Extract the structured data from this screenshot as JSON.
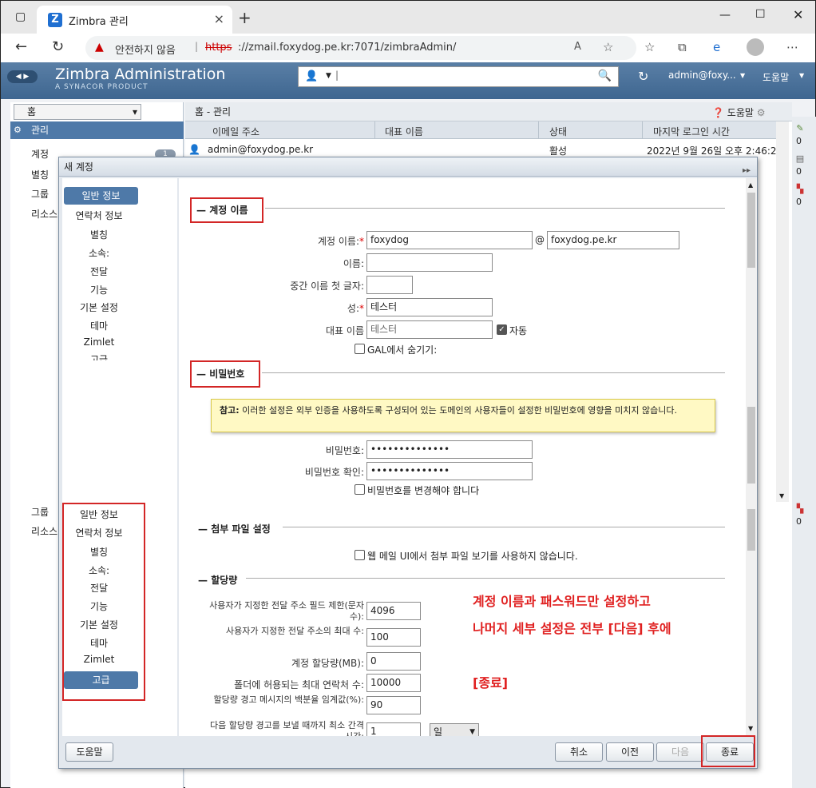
{
  "browser": {
    "tab_title": "Zimbra 관리",
    "tab_logo": "Z",
    "security_warning": "안전하지 않음",
    "url_scheme": "https",
    "url_rest": "://zmail.foxydog.pe.kr:7071/zimbraAdmin/"
  },
  "zimbra_header": {
    "brand": "Zimbra Administration",
    "subtitle": "A SYNACOR PRODUCT",
    "user": "admin@foxy...",
    "help": "도움말"
  },
  "left_panel": {
    "home_select": "홈",
    "management": "관리",
    "items": [
      "계정",
      "별칭",
      "그룹",
      "리소스"
    ],
    "account_count": "1",
    "lower_items": [
      "그룹",
      "리소스"
    ]
  },
  "main": {
    "breadcrumb": "홈 - 관리",
    "help": "도움말",
    "columns": [
      "이메일 주소",
      "대표 이름",
      "상태",
      "마지막 로그인 시간"
    ],
    "rows": [
      {
        "email": "admin@foxydog.pe.kr",
        "status": "활성",
        "last_login": "2022년 9월 26일 오후 2:46:23"
      }
    ]
  },
  "sidebar_counts": [
    "0",
    "0",
    "0",
    "0"
  ],
  "dialog": {
    "title": "새 계정",
    "nav_top": [
      "일반 정보",
      "연락처 정보",
      "별칭",
      "소속:",
      "전달",
      "기능",
      "기본 설정",
      "테마",
      "Zimlet",
      "고급"
    ],
    "nav_bottom": [
      "일반 정보",
      "연락처 정보",
      "별칭",
      "소속:",
      "전달",
      "기능",
      "기본 설정",
      "테마",
      "Zimlet",
      "고급"
    ],
    "section_account": "계정 이름",
    "account_name_label": "계정 이름:",
    "account_name_value": "foxydog",
    "at": "@",
    "domain_value": "foxydog.pe.kr",
    "first_name_label": "이름:",
    "middle_initial_label": "중간 이름 첫 글자:",
    "last_name_label": "성:",
    "last_name_value": "테스터",
    "display_name_label": "대표 이름",
    "display_name_value": "테스터",
    "auto_label": "자동",
    "hide_gal_label": "GAL에서 숨기기:",
    "section_password": "비밀번호",
    "note_bold": "참고:",
    "note_text": "이러한 설정은 외부 인증을 사용하도록 구성되어 있는 도메인의 사용자들이 설정한 비밀번호에 영향을 미치지 않습니다.",
    "password_label": "비밀번호:",
    "password_value": "••••••••••••••",
    "password_confirm_label": "비밀번호 확인:",
    "password_confirm_value": "••••••••••••••",
    "must_change_label": "비밀번호를 변경해야 합니다",
    "section_attachment": "첨부 파일 설정",
    "disable_attachment_label": "웹 메일 UI에서 첨부 파일 보기를 사용하지 않습니다.",
    "section_quota": "할당량",
    "quota_fields": [
      {
        "label": "사용자가 지정한 전달 주소 필드 제한(문자 수):",
        "value": "4096"
      },
      {
        "label": "사용자가 지정한 전달 주소의 최대 수:",
        "value": "100"
      },
      {
        "label": "계정 할당량(MB):",
        "value": "0"
      },
      {
        "label": "폴더에 허용되는 최대 연락처 수:",
        "value": "10000"
      },
      {
        "label": "할당량 경고 메시지의 백분율 임계값(%):",
        "value": "90"
      },
      {
        "label": "다음 할당량 경고를 보낼 때까지 최소 간격 시간:",
        "value": "1",
        "unit": "일"
      }
    ],
    "annotation_line1": "계정 이름과 패스워드만 설정하고",
    "annotation_line2": "나머지 세부 설정은 전부 [다음] 후에",
    "annotation_line3": "[종료]",
    "btn_help": "도움말",
    "btn_cancel": "취소",
    "btn_prev": "이전",
    "btn_next": "다음",
    "btn_finish": "종료"
  }
}
